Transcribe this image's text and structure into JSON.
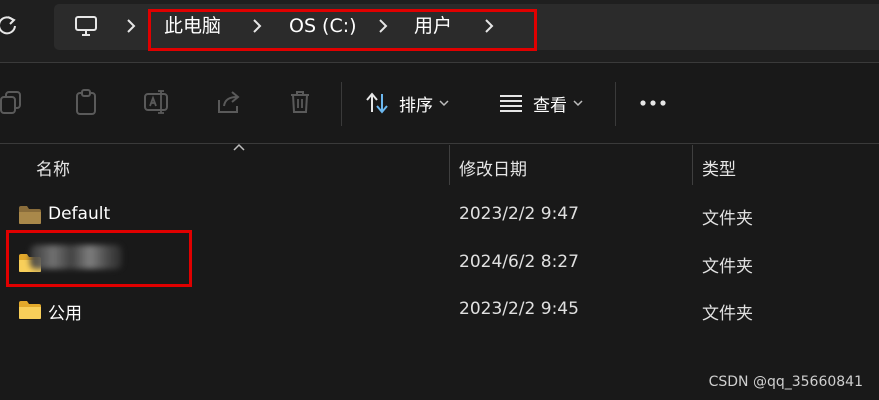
{
  "address_bar": {
    "crumbs": [
      "此电脑",
      "OS (C:)",
      "用户"
    ]
  },
  "toolbar": {
    "sort_label": "排序",
    "view_label": "查看"
  },
  "columns": {
    "name": "名称",
    "date": "修改日期",
    "type": "类型"
  },
  "files": [
    {
      "name": "Default",
      "date": "2023/2/2 9:47",
      "type": "文件夹"
    },
    {
      "name": "",
      "date": "2024/6/2 8:27",
      "type": "文件夹"
    },
    {
      "name": "公用",
      "date": "2023/2/2 9:45",
      "type": "文件夹"
    }
  ],
  "watermark": "CSDN @qq_35660841",
  "colors": {
    "background": "#191919",
    "address_bg": "#2b2b2b",
    "folder": "#f4c84a",
    "annotation_red": "#e00000"
  }
}
